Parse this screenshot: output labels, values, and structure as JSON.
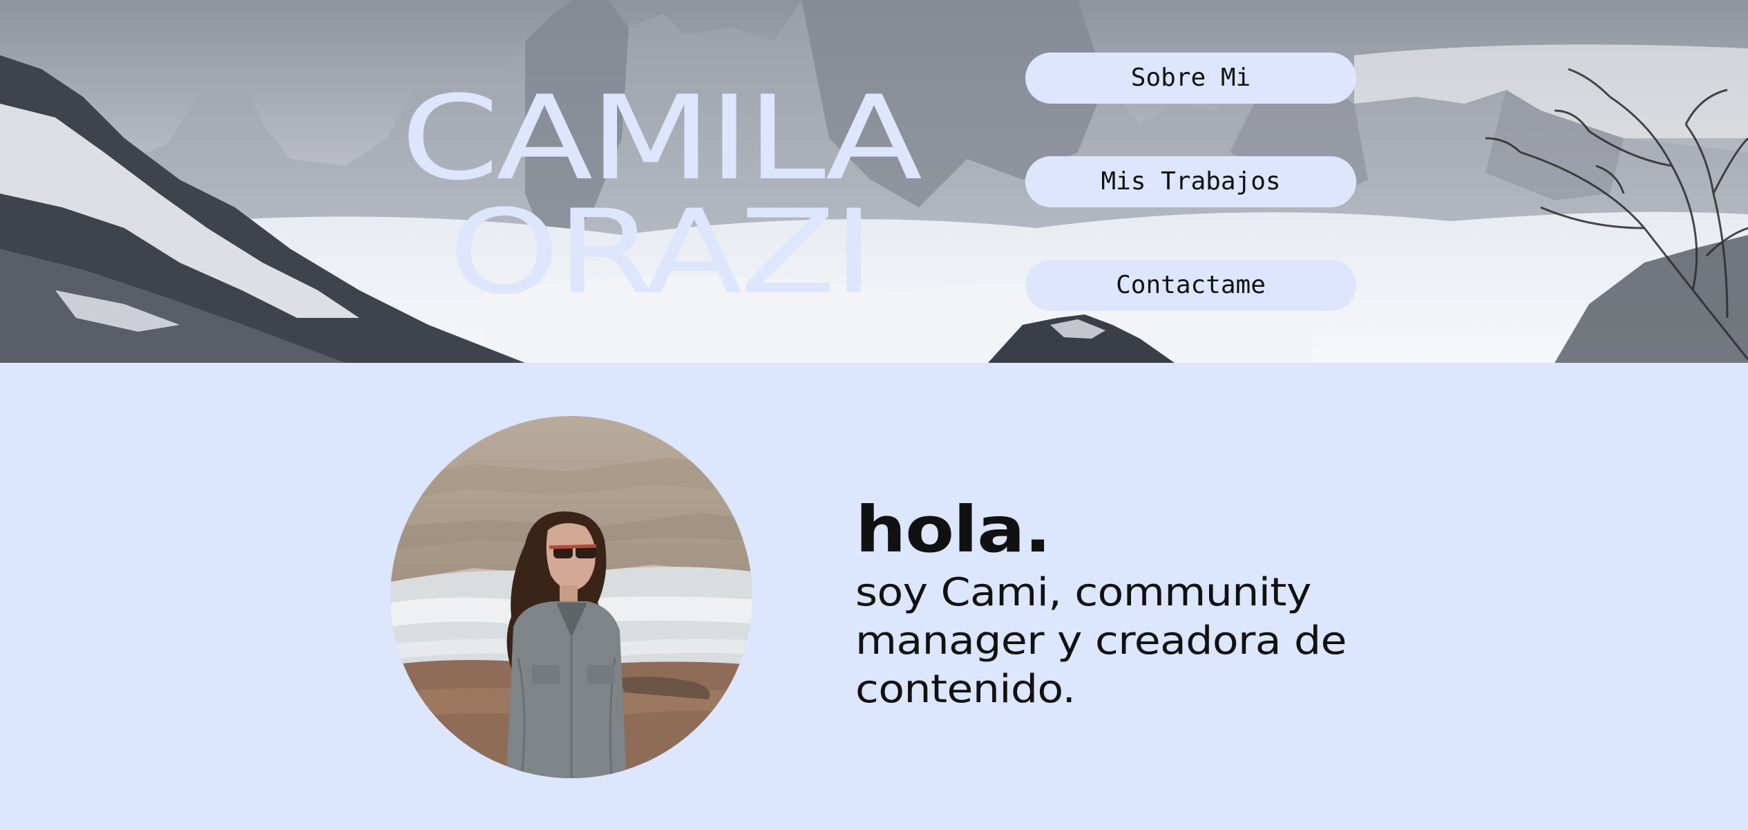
{
  "hero": {
    "title_line1": "CAMILA",
    "title_line2": "ORAZI"
  },
  "nav": {
    "items": [
      {
        "label": "Sobre Mi"
      },
      {
        "label": "Mis Trabajos"
      },
      {
        "label": "Contactame"
      }
    ]
  },
  "about": {
    "greeting": "hola.",
    "intro": "soy Cami, community manager y creadora de contenido."
  },
  "colors": {
    "accent": "#dce6fd",
    "text": "#111111"
  }
}
